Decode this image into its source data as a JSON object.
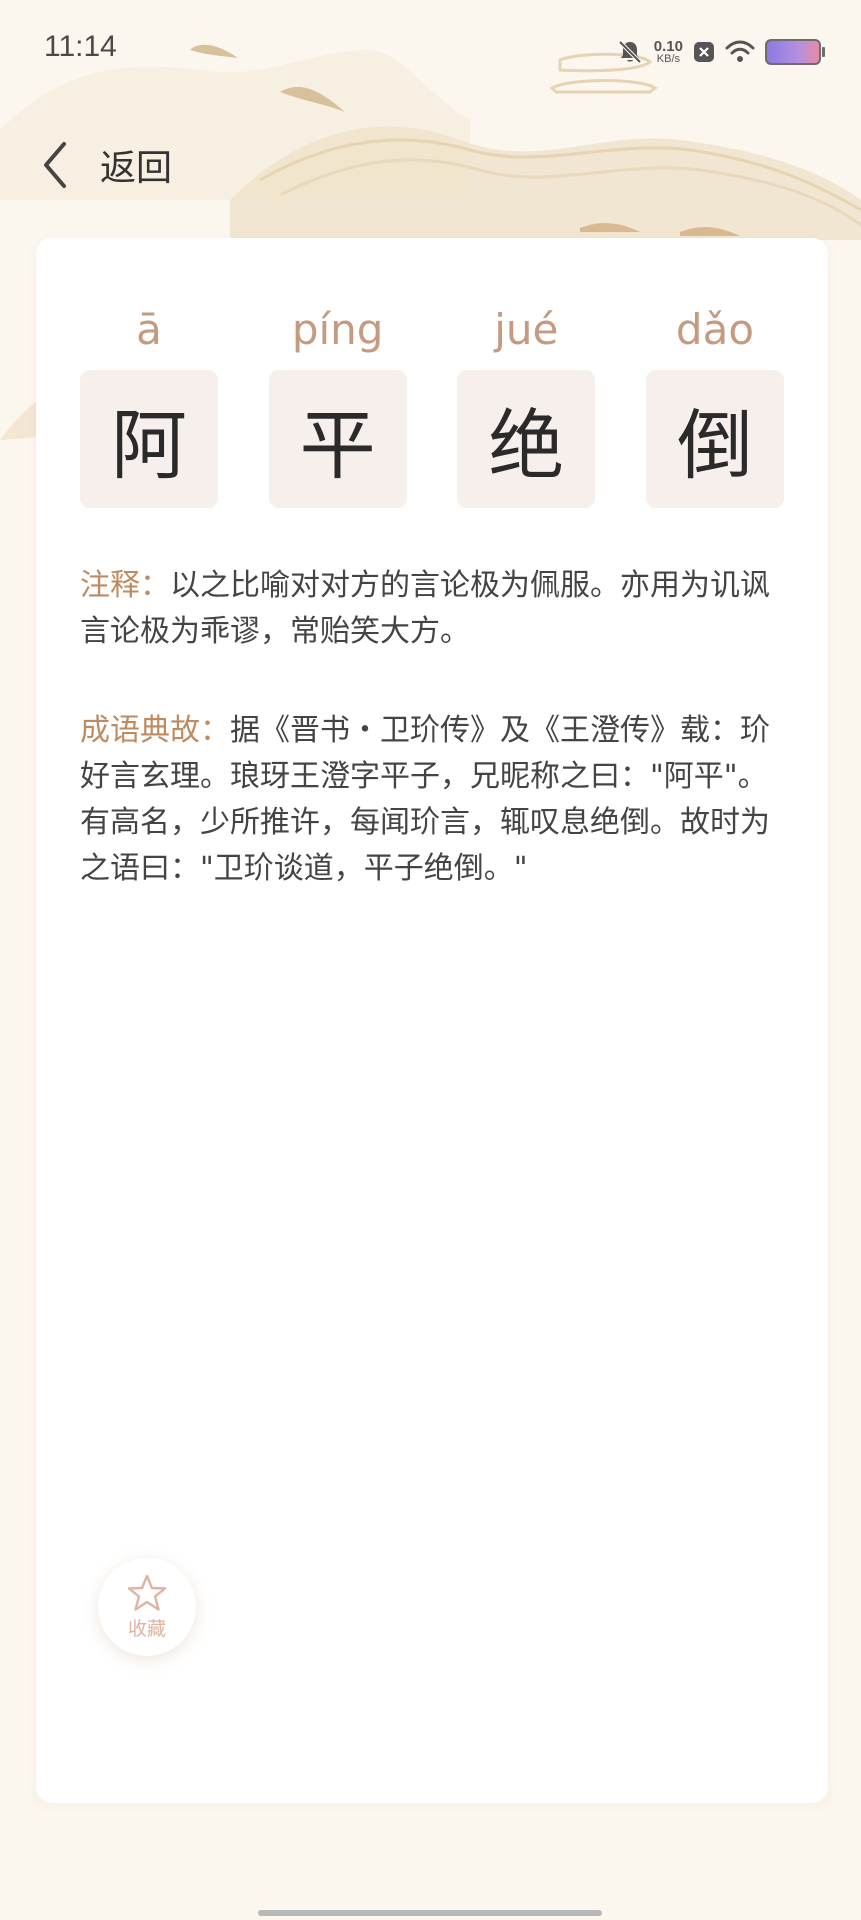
{
  "status_bar": {
    "time": "11:14",
    "net_speed_value": "0.10",
    "net_speed_unit": "KB/s",
    "icons": [
      "bell-off-icon",
      "close-box-icon",
      "wifi-icon",
      "battery-icon"
    ]
  },
  "header": {
    "back_label": "返回"
  },
  "idiom": {
    "chars": [
      {
        "pinyin": "ā",
        "char": "阿"
      },
      {
        "pinyin": "píng",
        "char": "平"
      },
      {
        "pinyin": "jué",
        "char": "绝"
      },
      {
        "pinyin": "dǎo",
        "char": "倒"
      }
    ]
  },
  "meaning": {
    "label": "注释：",
    "text": "以之比喻对对方的言论极为佩服。亦用为讥讽言论极为乖谬，常贻笑大方。"
  },
  "story": {
    "label": "成语典故：",
    "text": "据《晋书・卫玠传》及《王澄传》载：玠好言玄理。琅玡王澄字平子，兄昵称之曰：\"阿平\"。有高名，少所推许，每闻玠言，辄叹息绝倒。故时为之语曰：\"卫玠谈道，平子绝倒。\""
  },
  "favorite": {
    "label": "收藏"
  },
  "colors": {
    "background": "#fbf6ee",
    "accent_label": "#bf8a5f",
    "pinyin": "#c49a80",
    "char_box": "#f6efec"
  }
}
